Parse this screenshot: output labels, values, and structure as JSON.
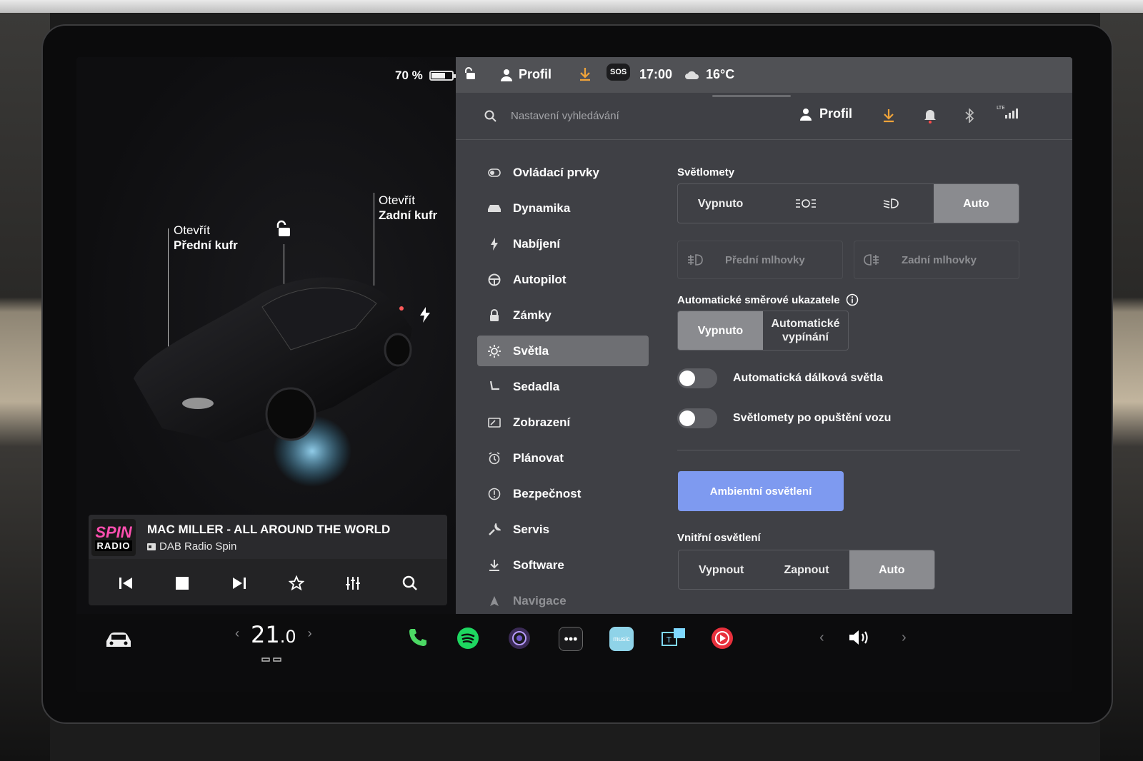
{
  "status": {
    "battery_pct": "70 %",
    "battery_level": 0.7,
    "profile": "Profil",
    "sos": "SOS",
    "time": "17:00",
    "temperature": "16°C"
  },
  "car_panel": {
    "front_trunk": {
      "line1": "Otevřít",
      "line2": "Přední kufr"
    },
    "rear_trunk": {
      "line1": "Otevřít",
      "line2": "Zadní kufr"
    }
  },
  "media": {
    "station_logo_top": "SPIN",
    "station_logo_bottom": "RADIO",
    "track": "MAC MILLER - ALL AROUND THE WORLD",
    "source": "DAB Radio Spin"
  },
  "settings": {
    "search_placeholder": "Nastavení vyhledávání",
    "profile": "Profil",
    "nav": [
      {
        "label": "Ovládací prvky",
        "icon": "toggle-icon"
      },
      {
        "label": "Dynamika",
        "icon": "car-icon"
      },
      {
        "label": "Nabíjení",
        "icon": "bolt-icon"
      },
      {
        "label": "Autopilot",
        "icon": "steering-wheel-icon"
      },
      {
        "label": "Zámky",
        "icon": "lock-icon"
      },
      {
        "label": "Světla",
        "icon": "sun-icon",
        "active": true
      },
      {
        "label": "Sedadla",
        "icon": "seat-icon"
      },
      {
        "label": "Zobrazení",
        "icon": "display-icon"
      },
      {
        "label": "Plánovat",
        "icon": "alarm-clock-icon"
      },
      {
        "label": "Bezpečnost",
        "icon": "info-circle-icon"
      },
      {
        "label": "Servis",
        "icon": "wrench-icon"
      },
      {
        "label": "Software",
        "icon": "download-icon"
      },
      {
        "label": "Navigace",
        "icon": "navigation-arrow-icon"
      }
    ],
    "headlights": {
      "title": "Světlomety",
      "options": [
        "Vypnuto",
        "",
        "",
        "Auto"
      ],
      "selected": "Auto"
    },
    "fog": {
      "front": "Přední mlhovky",
      "rear": "Zadní mlhovky"
    },
    "turn_signals": {
      "title": "Automatické směrové ukazatele",
      "off": "Vypnuto",
      "auto_line1": "Automatické",
      "auto_line2": "vypínání",
      "selected": "Vypnuto"
    },
    "auto_high_beam": {
      "label": "Automatická dálková světla",
      "on": false
    },
    "headlights_after_exit": {
      "label": "Světlomety po opuštění vozu",
      "on": false
    },
    "ambient_button": "Ambientní osvětlení",
    "interior": {
      "title": "Vnitřní osvětlení",
      "options": [
        "Vypnout",
        "Zapnout",
        "Auto"
      ],
      "selected": "Auto"
    }
  },
  "dock": {
    "temp_whole": "21",
    "temp_decimal": ".0"
  },
  "colors": {
    "accent_orange": "#f0a43a",
    "ambient_button": "#7e9af0",
    "spotify_green": "#1ed760",
    "phone_green": "#4cd964",
    "media_red": "#e8303c"
  }
}
